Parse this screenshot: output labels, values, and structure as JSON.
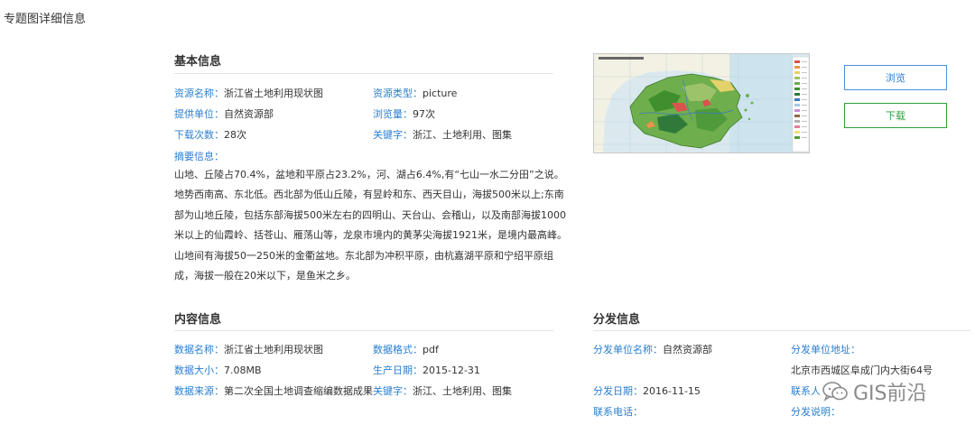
{
  "page": {
    "title": "专题图详细信息"
  },
  "basic": {
    "title": "基本信息",
    "resource_name_label": "资源名称：",
    "resource_name": "浙江省土地利用现状图",
    "resource_type_label": "资源类型：",
    "resource_type": "picture",
    "provider_label": "提供单位：",
    "provider": "自然资源部",
    "views_label": "浏览量：",
    "views": "97次",
    "downloads_label": "下载次数：",
    "downloads": "28次",
    "keywords_label": "关键字：",
    "keywords": "浙江、土地利用、图集",
    "summary_label": "摘要信息：",
    "summary": "山地、丘陵占70.4%，盆地和平原占23.2%，河、湖占6.4%,有“七山一水二分田”之说。地势西南高、东北低。西北部为低山丘陵，有昱岭和东、西天目山，海拔500米以上;东南部为山地丘陵，包括东部海拔500米左右的四明山、天台山、会稽山，以及南部海拔1000米以上的仙霞岭、括苍山、雁荡山等，龙泉市境内的黄茅尖海拔1921米，是境内最高峰。山地间有海拔50一250米的金衢盆地。东北部为冲积平原，由杭嘉湖平原和宁绍平原组成，海拔一般在20米以下，是鱼米之乡。"
  },
  "actions": {
    "browse_label": "浏览",
    "download_label": "下载"
  },
  "content": {
    "title": "内容信息",
    "data_name_label": "数据名称：",
    "data_name": "浙江省土地利用现状图",
    "data_format_label": "数据格式：",
    "data_format": "pdf",
    "data_size_label": "数据大小：",
    "data_size": "7.08MB",
    "production_date_label": "生产日期：",
    "production_date": "2015-12-31",
    "data_source_label": "数据来源：",
    "data_source": "第二次全国土地调查缩编数据成果",
    "keywords_label": "关键字：",
    "keywords": "浙江、土地利用、图集"
  },
  "distribution": {
    "title": "分发信息",
    "unit_name_label": "分发单位名称：",
    "unit_name": "自然资源部",
    "unit_address_label": "分发单位地址：",
    "unit_address": "北京市西城区阜成门内大街64号",
    "date_label": "分发日期：",
    "date": "2016-11-15",
    "contact_label": "联系人",
    "phone_label": "联系电话：",
    "note_label": "分发说明："
  },
  "watermark": {
    "text": "GIS前沿"
  },
  "colors": {
    "accent_blue": "#2a7fd0",
    "accent_green": "#2e9f3a",
    "divider": "#e6e6e6"
  }
}
